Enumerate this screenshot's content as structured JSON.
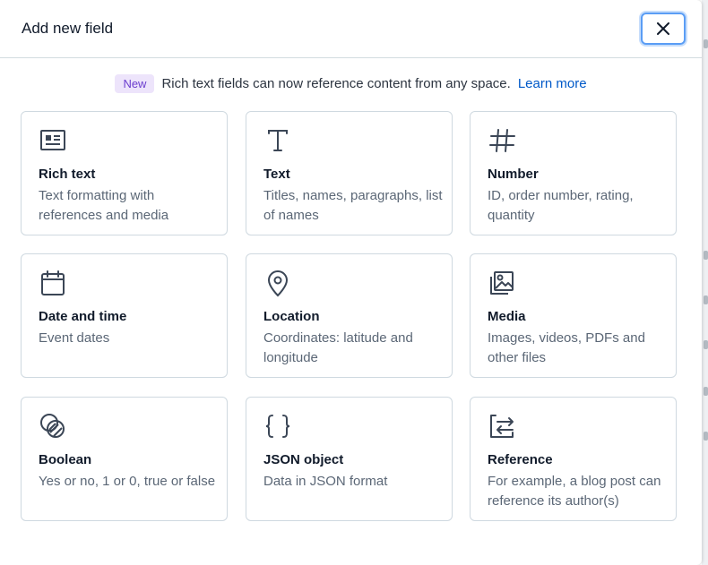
{
  "modal": {
    "title": "Add new field",
    "close_icon": "close-icon"
  },
  "notice": {
    "badge": "New",
    "text": "Rich text fields can now reference content from any space.",
    "link": "Learn more"
  },
  "field_types": [
    {
      "name": "Rich text",
      "desc": "Text formatting with references and media",
      "icon": "rich-text-icon"
    },
    {
      "name": "Text",
      "desc": "Titles, names, paragraphs, list of names",
      "icon": "text-icon"
    },
    {
      "name": "Number",
      "desc": "ID, order number, rating, quantity",
      "icon": "number-icon"
    },
    {
      "name": "Date and time",
      "desc": "Event dates",
      "icon": "calendar-icon"
    },
    {
      "name": "Location",
      "desc": "Coordinates: latitude and longitude",
      "icon": "location-pin-icon"
    },
    {
      "name": "Media",
      "desc": "Images, videos, PDFs and other files",
      "icon": "media-icon"
    },
    {
      "name": "Boolean",
      "desc": "Yes or no, 1 or 0, true or false",
      "icon": "boolean-icon"
    },
    {
      "name": "JSON object",
      "desc": "Data in JSON format",
      "icon": "json-icon"
    },
    {
      "name": "Reference",
      "desc": "For example, a blog post can reference its author(s)",
      "icon": "reference-icon"
    }
  ],
  "colors": {
    "accent": "#0059c8",
    "badge_bg": "#ede4fb",
    "badge_text": "#6c3ecf",
    "border": "#cfd9e0",
    "focus_ring": "#5a9df5"
  }
}
